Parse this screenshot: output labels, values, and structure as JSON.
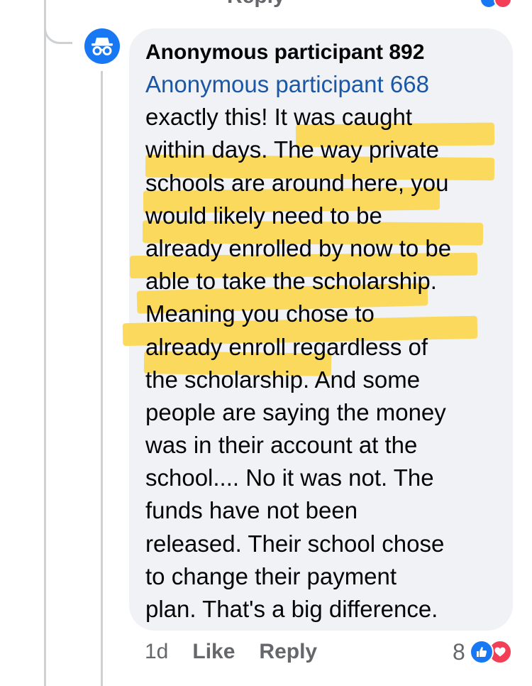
{
  "previous_comment": {
    "reply_fragment": "Reply"
  },
  "comment": {
    "author": "Anonymous participant 892",
    "mention": "Anonymous participant 668",
    "lines": [
      "exactly this! It was caught",
      "within days. The way private",
      "schools are around here, you",
      "would likely need to be",
      "already enrolled by now to be",
      "able to take the scholarship.",
      "Meaning you chose to",
      "already enroll regardless of",
      "the scholarship. And some",
      "people are saying the money",
      "was in their account at the",
      "school.... No it was not. The",
      "funds have not been",
      "released. Their school chose",
      "to change their payment",
      "plan. That's a big difference."
    ],
    "highlighted_text": "The way private schools are around here, you would likely need to be already enrolled by now to be able to take the scholarship. Meaning you chose to already enroll regardless of the scholarship.",
    "highlight_color": "#fad548"
  },
  "footer": {
    "time": "1d",
    "like_label": "Like",
    "reply_label": "Reply",
    "reaction_count": "8",
    "reactions": [
      "like-icon",
      "love-icon"
    ]
  },
  "colors": {
    "bubble": "#f0f2f5",
    "mention": "#1a57a6",
    "secondary_text": "#65676b",
    "like_blue": "#1877f2",
    "love_red": "#f33e58"
  },
  "icons": {
    "avatar": "incognito-icon"
  }
}
